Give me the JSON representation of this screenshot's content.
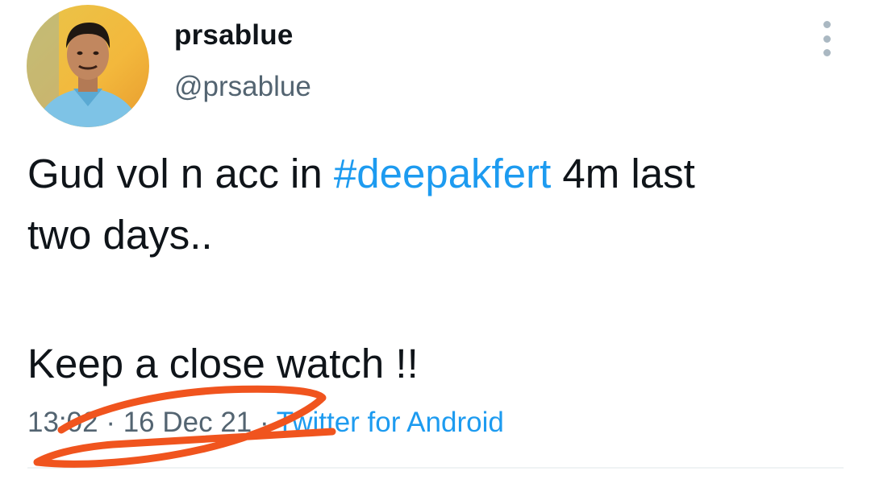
{
  "author": {
    "display_name": "prsablue",
    "handle": "@prsablue"
  },
  "tweet": {
    "line1_before": "Gud vol n acc in ",
    "hashtag": "#deepakfert",
    "line1_after": " 4m last",
    "line2": "two days..",
    "line3": "Keep a close watch !!"
  },
  "meta": {
    "time": "13:02",
    "separator": " · ",
    "date": "16 Dec 21",
    "source": "Twitter for Android"
  },
  "colors": {
    "link": "#1d9bf0",
    "secondary_text": "#536471",
    "annotation_stroke": "#f0541e"
  },
  "icons": {
    "more": "vertical-ellipsis-icon"
  }
}
